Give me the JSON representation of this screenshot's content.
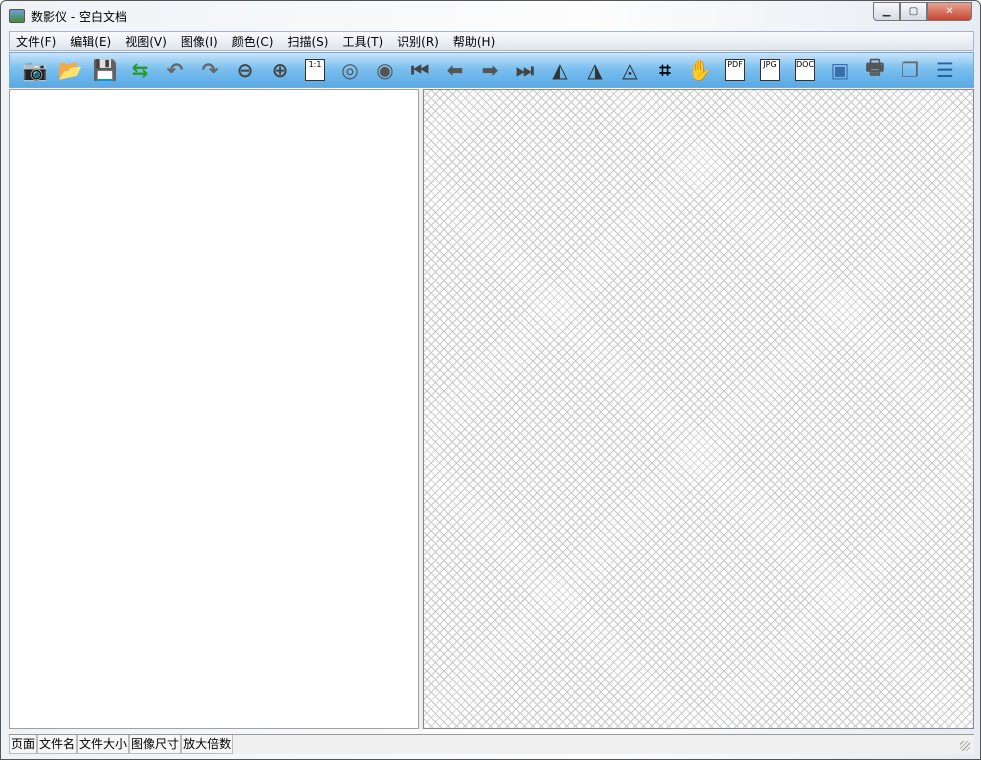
{
  "window": {
    "title": "数影仪 - 空白文档"
  },
  "menu": [
    "文件(F)",
    "编辑(E)",
    "视图(V)",
    "图像(I)",
    "颜色(C)",
    "扫描(S)",
    "工具(T)",
    "识别(R)",
    "帮助(H)"
  ],
  "toolbar": [
    {
      "name": "camera-icon",
      "glyph": "📷",
      "color": "#a3203a"
    },
    {
      "name": "open-folder-icon",
      "glyph": "📂",
      "color": "#d8a020"
    },
    {
      "name": "save-icon",
      "glyph": "💾",
      "color": "#555"
    },
    {
      "name": "swap-view-icon",
      "glyph": "⇆",
      "color": "#2a9a2a"
    },
    {
      "name": "rotate-left-icon",
      "glyph": "↶",
      "color": "#666"
    },
    {
      "name": "rotate-right-icon",
      "glyph": "↷",
      "color": "#666"
    },
    {
      "name": "zoom-out-icon",
      "glyph": "⊖",
      "color": "#444"
    },
    {
      "name": "zoom-in-icon",
      "glyph": "⊕",
      "color": "#444"
    },
    {
      "name": "actual-size-icon",
      "doc": "1:1"
    },
    {
      "name": "film-reel-icon",
      "glyph": "◎",
      "color": "#555"
    },
    {
      "name": "film-reel-2-icon",
      "glyph": "◉",
      "color": "#555"
    },
    {
      "name": "first-page-icon",
      "glyph": "⏮",
      "color": "#444"
    },
    {
      "name": "previous-icon",
      "glyph": "⬅",
      "color": "#555"
    },
    {
      "name": "next-icon",
      "glyph": "➡",
      "color": "#555"
    },
    {
      "name": "last-page-icon",
      "glyph": "⏭",
      "color": "#444"
    },
    {
      "name": "deskew-left-icon",
      "glyph": "◭",
      "color": "#333"
    },
    {
      "name": "deskew-right-icon",
      "glyph": "◮",
      "color": "#333"
    },
    {
      "name": "deskew-auto-icon",
      "glyph": "◬",
      "color": "#333"
    },
    {
      "name": "crop-icon",
      "glyph": "⌗",
      "color": "#000"
    },
    {
      "name": "hand-icon",
      "glyph": "✋",
      "color": "#888"
    },
    {
      "name": "pdf-icon",
      "doc": "PDF"
    },
    {
      "name": "jpg-icon",
      "doc": "JPG"
    },
    {
      "name": "doc-icon",
      "doc": "DOC"
    },
    {
      "name": "scanner-camera-icon",
      "glyph": "▣",
      "color": "#3a6ea8"
    },
    {
      "name": "print-icon",
      "glyph": "🖶",
      "color": "#555"
    },
    {
      "name": "copy-icon",
      "glyph": "❐",
      "color": "#666"
    },
    {
      "name": "window-icon",
      "glyph": "☰",
      "color": "#2a5e9a"
    }
  ],
  "status": [
    "页面",
    "文件名",
    "文件大小",
    "图像尺寸",
    "放大倍数"
  ]
}
